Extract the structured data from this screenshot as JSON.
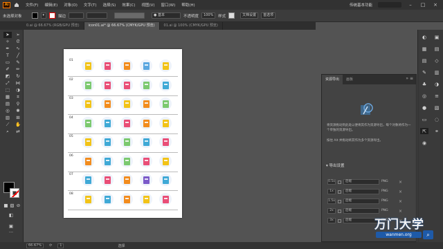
{
  "app": {
    "logo": "Ai"
  },
  "menu": {
    "items": [
      "文件(F)",
      "编辑(E)",
      "对象(O)",
      "文字(T)",
      "选择(S)",
      "效果(C)",
      "视图(V)",
      "窗口(W)",
      "帮助(H)"
    ],
    "workspace": "传统基本功能"
  },
  "control": {
    "selection": "未选择对象",
    "stroke_label": "描边",
    "style": "基本",
    "opacity_label": "不透明度",
    "opacity_value": "100%",
    "style_label": "样式",
    "doc_setup": "文档设置",
    "prefs": "首选项"
  },
  "tabs": [
    {
      "label": "0.ai @ 66.67% (RGB/GPU 预览)",
      "active": false
    },
    {
      "label": "icon01.ai* @ 66.67% (CMYK/GPU 预览)",
      "active": true
    },
    {
      "label": "01.ai @ 100% (CMYK/GPU 预览)",
      "active": false
    }
  ],
  "artboard": {
    "rows": [
      {
        "num": "01",
        "colors": [
          "#f2c318",
          "#e94e77",
          "#f28c1e",
          "#5aa6e0",
          "#f2c318"
        ]
      },
      {
        "num": "02",
        "colors": [
          "#7bc96f",
          "#e94e77",
          "#e94e77",
          "#7bc96f",
          "#3fa9d6"
        ]
      },
      {
        "num": "03",
        "colors": [
          "#f2c318",
          "#f28c1e",
          "#f2c318",
          "#f28c1e",
          "#7bc96f"
        ]
      },
      {
        "num": "04",
        "colors": [
          "#7bc96f",
          "#3fa9d6",
          "#e94e77",
          "#f28c1e",
          "#f2c318"
        ]
      },
      {
        "num": "05",
        "colors": [
          "#f2c318",
          "#3fa9d6",
          "#7bc96f",
          "#3fa9d6",
          "#e94e77"
        ]
      },
      {
        "num": "06",
        "colors": [
          "#f28c1e",
          "#3fa9d6",
          "#7bc96f",
          "#e94e77",
          "#f2c318"
        ]
      },
      {
        "num": "07",
        "colors": [
          "#3fa9d6",
          "#e94e77",
          "#f28c1e",
          "#7b5ac9",
          "#3fa9d6"
        ]
      },
      {
        "num": "08",
        "colors": [
          "#f2c318",
          "#3fa9d6",
          "#f28c1e",
          "#f2c318",
          "#e94e77"
        ]
      }
    ]
  },
  "panel": {
    "tabs": [
      "资源导出",
      "画板"
    ],
    "hint1": "将资源拖动到此处以便将其作为资源导出，每个对象将作为一个单独的资源导出。",
    "hint2": "按住 Alt 并拖动将其作为多个资源导出。",
    "export_title": "导出设置",
    "export_rows": [
      {
        "scale": "0.5x",
        "suffix": "后缀",
        "format": "PNG"
      },
      {
        "scale": "1x",
        "suffix": "后缀",
        "format": "PNG"
      },
      {
        "scale": "1.5x",
        "suffix": "后缀",
        "format": "PNG"
      },
      {
        "scale": "2x",
        "suffix": "后缀",
        "format": "PNG"
      },
      {
        "scale": "3x",
        "suffix": "后缀",
        "format": "PNG"
      }
    ]
  },
  "status": {
    "zoom": "66.67%",
    "page": "1",
    "tool": "选择"
  },
  "watermark": {
    "title": "万门大学",
    "url": "wanmen.org",
    "search_icon": "search-icon"
  },
  "colors": {
    "accent": "#1e5aa8",
    "brand": "#ff7c00"
  }
}
